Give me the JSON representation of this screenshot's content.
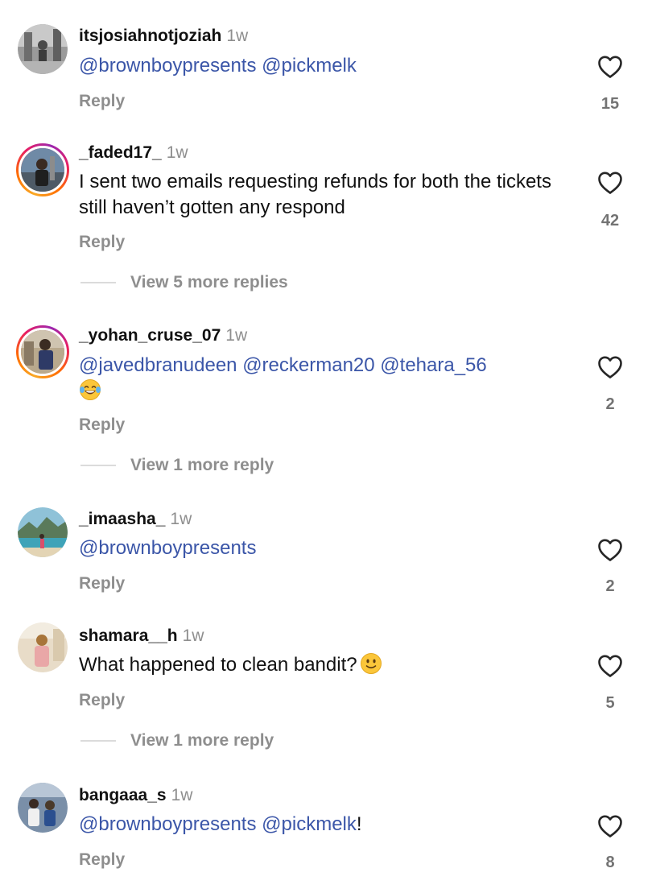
{
  "comments": [
    {
      "username": "itsjosiahnotjoziah",
      "time": "1w",
      "mentions": [
        "@brownboypresents",
        "@pickmelk"
      ],
      "reply_label": "Reply",
      "likes": "15"
    },
    {
      "username": "_faded17_",
      "time": "1w",
      "text": "I sent two emails requesting refunds for both the tickets still haven’t gotten any respond",
      "reply_label": "Reply",
      "likes": "42",
      "more_replies": "View 5 more replies"
    },
    {
      "username": "_yohan_cruse_07",
      "time": "1w",
      "mentions": [
        "@javedbranudeen",
        "@reckerman20",
        "@tehara_56"
      ],
      "emoji": "laughing-tears-emoji",
      "reply_label": "Reply",
      "likes": "2",
      "more_replies": "View 1 more reply"
    },
    {
      "username": "_imaasha_",
      "time": "1w",
      "mentions": [
        "@brownboypresents"
      ],
      "reply_label": "Reply",
      "likes": "2"
    },
    {
      "username": "shamara__h",
      "time": "1w",
      "text": "What happened to clean bandit?",
      "emoji": "slight-smile-emoji",
      "reply_label": "Reply",
      "likes": "5",
      "more_replies": "View 1 more reply"
    },
    {
      "username": "bangaaa_s",
      "time": "1w",
      "mentions": [
        "@brownboypresents",
        "@pickmelk"
      ],
      "suffix": "!",
      "reply_label": "Reply",
      "likes": "8"
    }
  ],
  "colors": {
    "mention": "#3b56a8",
    "muted": "#8e8e8e",
    "count": "#737373"
  }
}
